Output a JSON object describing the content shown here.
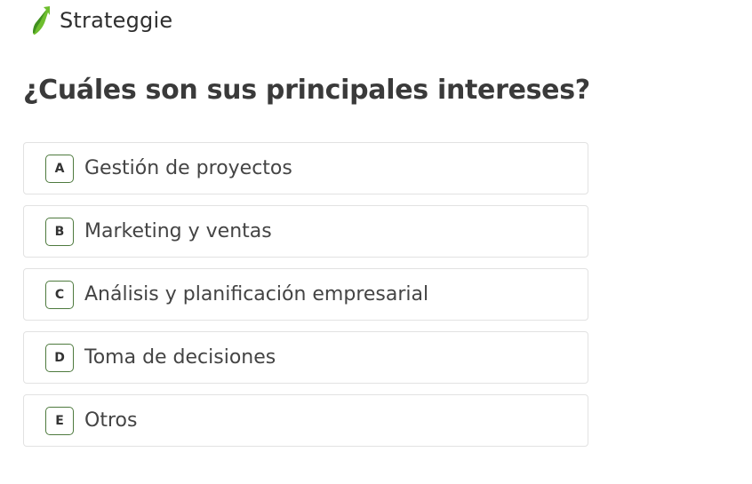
{
  "brand": {
    "name": "Strateggie",
    "logo_icon": "leaf-arrow-logo-icon",
    "accent_color": "#6ebe2e",
    "accent_dark": "#3f8f1f"
  },
  "question": {
    "title": "¿Cuáles son sus principales intereses?"
  },
  "options": [
    {
      "key": "A",
      "label": "Gestión de proyectos"
    },
    {
      "key": "B",
      "label": "Marketing y ventas"
    },
    {
      "key": "C",
      "label": "Análisis y planificación empresarial"
    },
    {
      "key": "D",
      "label": "Toma de decisiones"
    },
    {
      "key": "E",
      "label": "Otros"
    }
  ],
  "colors": {
    "key_border": "#4e7a3e",
    "option_border": "#e2e2e2",
    "text": "#3a3a3a"
  }
}
